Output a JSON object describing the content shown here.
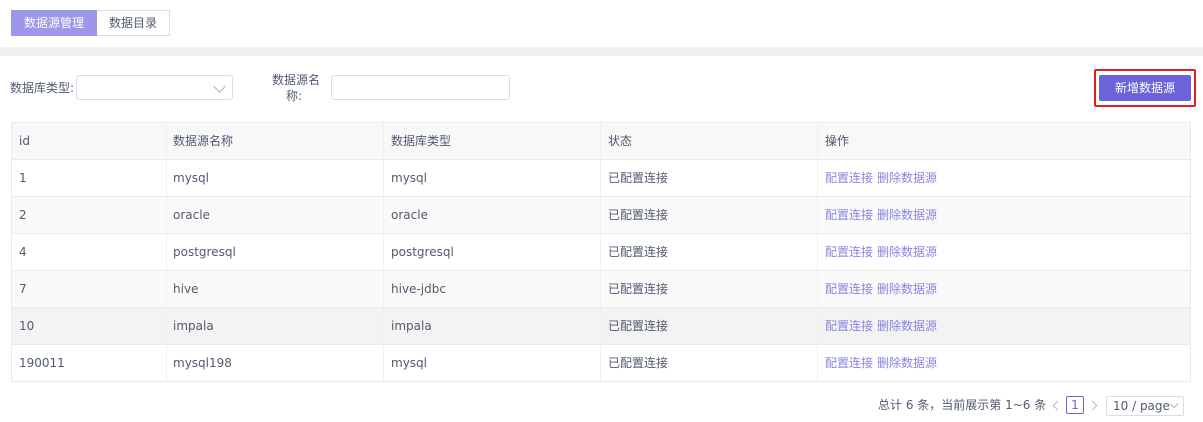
{
  "tabs": [
    {
      "label": "数据源管理",
      "active": true
    },
    {
      "label": "数据目录",
      "active": false
    }
  ],
  "filters": {
    "db_type_label": "数据库类型:",
    "db_type_value": "",
    "name_label_line1": "数据源名",
    "name_label_line2": "称:",
    "name_value": ""
  },
  "toolbar": {
    "add_label": "新增数据源",
    "accent": "#6c63d9",
    "highlight_border": "#e02020"
  },
  "table": {
    "columns": [
      "id",
      "数据源名称",
      "数据库类型",
      "状态",
      "操作"
    ],
    "rows": [
      {
        "id": "1",
        "name": "mysql",
        "type": "mysql",
        "status": "已配置连接",
        "action1": "配置连接",
        "action2": "删除数据源"
      },
      {
        "id": "2",
        "name": "oracle",
        "type": "oracle",
        "status": "已配置连接",
        "action1": "配置连接",
        "action2": "删除数据源"
      },
      {
        "id": "4",
        "name": "postgresql",
        "type": "postgresql",
        "status": "已配置连接",
        "action1": "配置连接",
        "action2": "删除数据源"
      },
      {
        "id": "7",
        "name": "hive",
        "type": "hive-jdbc",
        "status": "已配置连接",
        "action1": "配置连接",
        "action2": "删除数据源"
      },
      {
        "id": "10",
        "name": "impala",
        "type": "impala",
        "status": "已配置连接",
        "action1": "配置连接",
        "action2": "删除数据源"
      },
      {
        "id": "190011",
        "name": "mysql198",
        "type": "mysql",
        "status": "已配置连接",
        "action1": "配置连接",
        "action2": "删除数据源"
      }
    ]
  },
  "pagination": {
    "summary": "总计 6 条，当前展示第 1~6 条",
    "current_page": "1",
    "page_size": "10 / page",
    "prev_icon": "chevron-left-icon",
    "next_icon": "chevron-right-icon"
  }
}
